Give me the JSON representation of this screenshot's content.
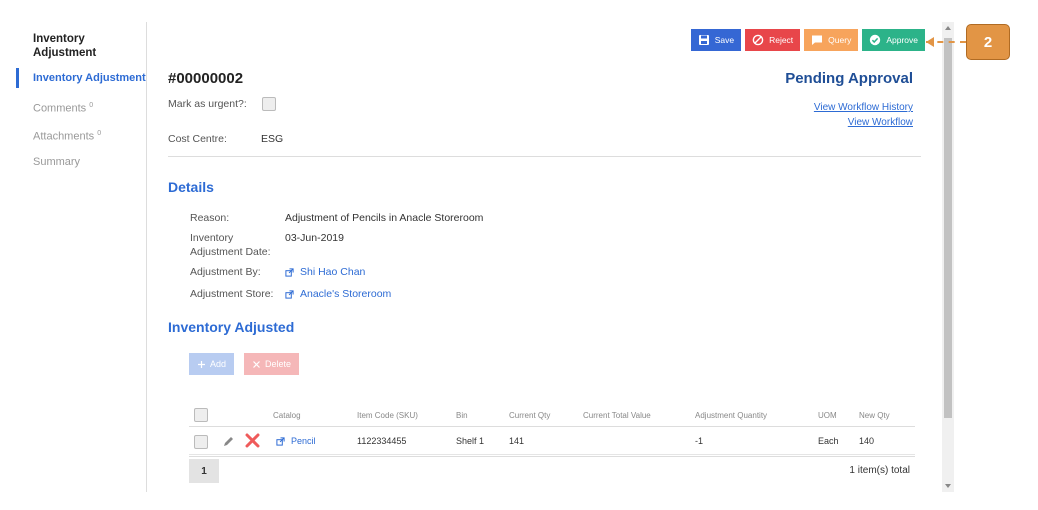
{
  "sidebar": {
    "title": "Inventory Adjustment",
    "items": [
      {
        "label": "Inventory Adjustment",
        "sup": ""
      },
      {
        "label": "Comments",
        "sup": "0"
      },
      {
        "label": "Attachments",
        "sup": "0"
      },
      {
        "label": "Summary",
        "sup": ""
      }
    ]
  },
  "toolbar": {
    "save": "Save",
    "reject": "Reject",
    "query": "Query",
    "approve": "Approve"
  },
  "header": {
    "doc_number": "#00000002",
    "status": "Pending Approval",
    "workflow_history_link": "View Workflow History",
    "workflow_link": "View Workflow",
    "urgent_label": "Mark as urgent?:",
    "cost_centre_label": "Cost Centre:",
    "cost_centre_value": "ESG"
  },
  "details": {
    "title": "Details",
    "reason_label": "Reason:",
    "reason_value": "Adjustment of Pencils in Anacle Storeroom",
    "date_label_1": "Inventory",
    "date_label_2": "Adjustment Date:",
    "date_value": "03-Jun-2019",
    "by_label": "Adjustment By:",
    "by_value": "Shi Hao Chan",
    "store_label": "Adjustment Store:",
    "store_value": "Anacle's Storeroom"
  },
  "inventory": {
    "title": "Inventory Adjusted",
    "add_label": "Add",
    "delete_label": "Delete",
    "columns": [
      "Catalog",
      "Item Code (SKU)",
      "Bin",
      "Current Qty",
      "Current Total Value",
      "Adjustment Quantity",
      "UOM",
      "New Qty"
    ],
    "rows": [
      {
        "catalog": "Pencil",
        "sku": "1122334455",
        "bin": "Shelf 1",
        "current_qty": "141",
        "current_total_value": "",
        "adjustment_qty": "-1",
        "uom": "Each",
        "new_qty": "140"
      }
    ],
    "page": "1",
    "total": "1 item(s) total"
  },
  "callout": {
    "number": "2"
  },
  "colors": {
    "accent": "#2d6bd4",
    "save": "#3567d4",
    "reject": "#e8464a",
    "query": "#f7a45c",
    "approve": "#2cb389",
    "callout": "#e29545"
  },
  "icons": [
    "floppy-icon",
    "no-entry-icon",
    "speech-bubble-icon",
    "check-circle-icon",
    "external-link-icon",
    "pencil-icon",
    "delete-x-icon",
    "plus-icon"
  ]
}
